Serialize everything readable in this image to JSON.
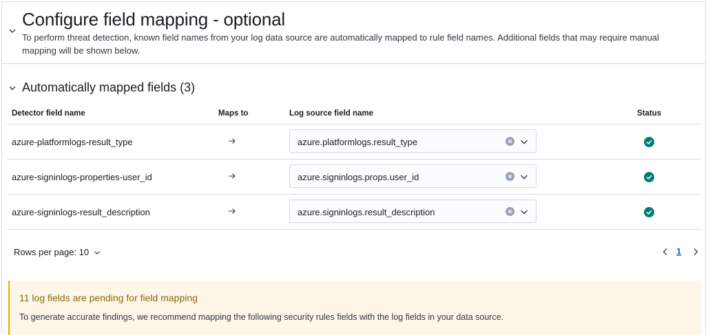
{
  "header": {
    "title": "Configure field mapping - optional",
    "description": "To perform threat detection, known field names from your log data source are automatically mapped to rule field names. Additional fields that may require manual mapping will be shown below."
  },
  "section": {
    "title": "Automatically mapped fields (3)"
  },
  "table": {
    "columns": [
      "Detector field name",
      "Maps to",
      "Log source field name",
      "Status"
    ],
    "rows": [
      {
        "detector_field": "azure-platformlogs-result_type",
        "log_field": "azure.platformlogs.result_type",
        "status": "mapped"
      },
      {
        "detector_field": "azure-signinlogs-properties-user_id",
        "log_field": "azure.signinlogs.props.user_id",
        "status": "mapped"
      },
      {
        "detector_field": "azure-signinlogs-result_description",
        "log_field": "azure.signinlogs.result_description",
        "status": "mapped"
      }
    ]
  },
  "pagination": {
    "rows_per_page_label": "Rows per page: 10",
    "current_page": "1"
  },
  "callout": {
    "title": "11 log fields are pending for field mapping",
    "text": "To generate accurate findings, we recommend mapping the following security rules fields with the log fields in your data source."
  },
  "colors": {
    "accent": "#006bb8",
    "success": "#017d73",
    "warning_bg": "#fef6e6",
    "warning_text": "#8a6a0a",
    "border": "#d3dae6"
  },
  "icons": {
    "collapse": "chevron-down-icon",
    "maps_to": "arrow-right-icon",
    "clear": "clear-icon",
    "dropdown": "chevron-down-icon",
    "status": "check-circle-icon",
    "prev": "chevron-left-icon",
    "next": "chevron-right-icon"
  }
}
